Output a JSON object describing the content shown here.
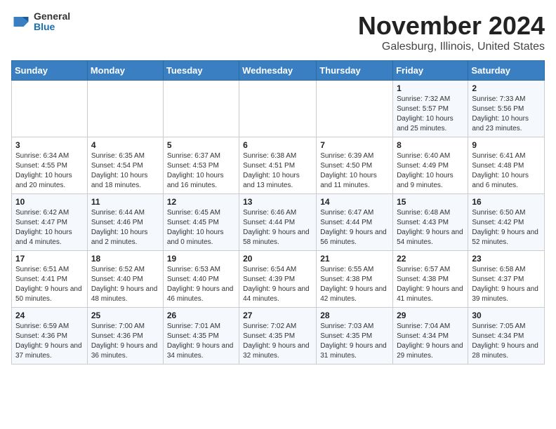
{
  "header": {
    "logo_general": "General",
    "logo_blue": "Blue",
    "title": "November 2024",
    "subtitle": "Galesburg, Illinois, United States"
  },
  "calendar": {
    "days_of_week": [
      "Sunday",
      "Monday",
      "Tuesday",
      "Wednesday",
      "Thursday",
      "Friday",
      "Saturday"
    ],
    "weeks": [
      [
        {
          "day": "",
          "info": ""
        },
        {
          "day": "",
          "info": ""
        },
        {
          "day": "",
          "info": ""
        },
        {
          "day": "",
          "info": ""
        },
        {
          "day": "",
          "info": ""
        },
        {
          "day": "1",
          "info": "Sunrise: 7:32 AM\nSunset: 5:57 PM\nDaylight: 10 hours and 25 minutes."
        },
        {
          "day": "2",
          "info": "Sunrise: 7:33 AM\nSunset: 5:56 PM\nDaylight: 10 hours and 23 minutes."
        }
      ],
      [
        {
          "day": "3",
          "info": "Sunrise: 6:34 AM\nSunset: 4:55 PM\nDaylight: 10 hours and 20 minutes."
        },
        {
          "day": "4",
          "info": "Sunrise: 6:35 AM\nSunset: 4:54 PM\nDaylight: 10 hours and 18 minutes."
        },
        {
          "day": "5",
          "info": "Sunrise: 6:37 AM\nSunset: 4:53 PM\nDaylight: 10 hours and 16 minutes."
        },
        {
          "day": "6",
          "info": "Sunrise: 6:38 AM\nSunset: 4:51 PM\nDaylight: 10 hours and 13 minutes."
        },
        {
          "day": "7",
          "info": "Sunrise: 6:39 AM\nSunset: 4:50 PM\nDaylight: 10 hours and 11 minutes."
        },
        {
          "day": "8",
          "info": "Sunrise: 6:40 AM\nSunset: 4:49 PM\nDaylight: 10 hours and 9 minutes."
        },
        {
          "day": "9",
          "info": "Sunrise: 6:41 AM\nSunset: 4:48 PM\nDaylight: 10 hours and 6 minutes."
        }
      ],
      [
        {
          "day": "10",
          "info": "Sunrise: 6:42 AM\nSunset: 4:47 PM\nDaylight: 10 hours and 4 minutes."
        },
        {
          "day": "11",
          "info": "Sunrise: 6:44 AM\nSunset: 4:46 PM\nDaylight: 10 hours and 2 minutes."
        },
        {
          "day": "12",
          "info": "Sunrise: 6:45 AM\nSunset: 4:45 PM\nDaylight: 10 hours and 0 minutes."
        },
        {
          "day": "13",
          "info": "Sunrise: 6:46 AM\nSunset: 4:44 PM\nDaylight: 9 hours and 58 minutes."
        },
        {
          "day": "14",
          "info": "Sunrise: 6:47 AM\nSunset: 4:44 PM\nDaylight: 9 hours and 56 minutes."
        },
        {
          "day": "15",
          "info": "Sunrise: 6:48 AM\nSunset: 4:43 PM\nDaylight: 9 hours and 54 minutes."
        },
        {
          "day": "16",
          "info": "Sunrise: 6:50 AM\nSunset: 4:42 PM\nDaylight: 9 hours and 52 minutes."
        }
      ],
      [
        {
          "day": "17",
          "info": "Sunrise: 6:51 AM\nSunset: 4:41 PM\nDaylight: 9 hours and 50 minutes."
        },
        {
          "day": "18",
          "info": "Sunrise: 6:52 AM\nSunset: 4:40 PM\nDaylight: 9 hours and 48 minutes."
        },
        {
          "day": "19",
          "info": "Sunrise: 6:53 AM\nSunset: 4:40 PM\nDaylight: 9 hours and 46 minutes."
        },
        {
          "day": "20",
          "info": "Sunrise: 6:54 AM\nSunset: 4:39 PM\nDaylight: 9 hours and 44 minutes."
        },
        {
          "day": "21",
          "info": "Sunrise: 6:55 AM\nSunset: 4:38 PM\nDaylight: 9 hours and 42 minutes."
        },
        {
          "day": "22",
          "info": "Sunrise: 6:57 AM\nSunset: 4:38 PM\nDaylight: 9 hours and 41 minutes."
        },
        {
          "day": "23",
          "info": "Sunrise: 6:58 AM\nSunset: 4:37 PM\nDaylight: 9 hours and 39 minutes."
        }
      ],
      [
        {
          "day": "24",
          "info": "Sunrise: 6:59 AM\nSunset: 4:36 PM\nDaylight: 9 hours and 37 minutes."
        },
        {
          "day": "25",
          "info": "Sunrise: 7:00 AM\nSunset: 4:36 PM\nDaylight: 9 hours and 36 minutes."
        },
        {
          "day": "26",
          "info": "Sunrise: 7:01 AM\nSunset: 4:35 PM\nDaylight: 9 hours and 34 minutes."
        },
        {
          "day": "27",
          "info": "Sunrise: 7:02 AM\nSunset: 4:35 PM\nDaylight: 9 hours and 32 minutes."
        },
        {
          "day": "28",
          "info": "Sunrise: 7:03 AM\nSunset: 4:35 PM\nDaylight: 9 hours and 31 minutes."
        },
        {
          "day": "29",
          "info": "Sunrise: 7:04 AM\nSunset: 4:34 PM\nDaylight: 9 hours and 29 minutes."
        },
        {
          "day": "30",
          "info": "Sunrise: 7:05 AM\nSunset: 4:34 PM\nDaylight: 9 hours and 28 minutes."
        }
      ]
    ]
  }
}
